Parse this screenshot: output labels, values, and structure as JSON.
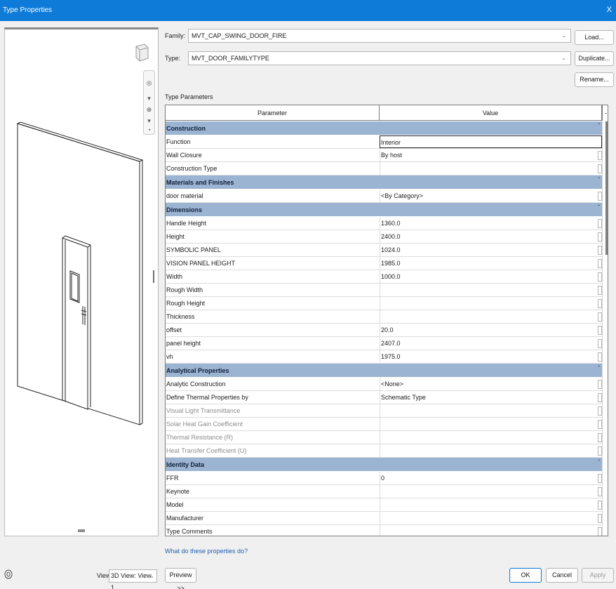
{
  "window": {
    "title": "Type Properties",
    "close_glyph": "X"
  },
  "family": {
    "label": "Family:",
    "value": "MVT_CAP_SWING_DOOR_FIRE",
    "load_button": "Load..."
  },
  "type": {
    "label": "Type:",
    "value": "MVT_DOOR_FAMILYTYPE",
    "duplicate_button": "Duplicate...",
    "rename_button": "Rename..."
  },
  "type_parameters_label": "Type Parameters",
  "table": {
    "header_parameter": "Parameter",
    "header_value": "Value",
    "header_minus": "-",
    "groups": [
      {
        "name": "Construction",
        "rows": [
          {
            "parameter": "Function",
            "value": "Interior",
            "selected": true
          },
          {
            "parameter": "Wall Closure",
            "value": "By host"
          },
          {
            "parameter": "Construction Type",
            "value": ""
          }
        ]
      },
      {
        "name": "Materials and Finishes",
        "rows": [
          {
            "parameter": "door material",
            "value": "<By Category>"
          }
        ]
      },
      {
        "name": "Dimensions",
        "rows": [
          {
            "parameter": "Handle Height",
            "value": "1360.0"
          },
          {
            "parameter": "Height",
            "value": "2400.0"
          },
          {
            "parameter": "SYMBOLIC PANEL",
            "value": "1024.0"
          },
          {
            "parameter": "VISION PANEL HEIGHT",
            "value": "1985.0"
          },
          {
            "parameter": "Width",
            "value": "1000.0"
          },
          {
            "parameter": "Rough Width",
            "value": ""
          },
          {
            "parameter": "Rough Height",
            "value": ""
          },
          {
            "parameter": "Thickness",
            "value": ""
          },
          {
            "parameter": "offset",
            "value": "20.0"
          },
          {
            "parameter": "panel height",
            "value": "2407.0"
          },
          {
            "parameter": "vh",
            "value": "1975.0"
          }
        ]
      },
      {
        "name": "Analytical Properties",
        "rows": [
          {
            "parameter": "Analytic Construction",
            "value": "<None>"
          },
          {
            "parameter": "Define Thermal Properties by",
            "value": "Schematic Type"
          },
          {
            "parameter": "Visual Light Transmittance",
            "value": "",
            "disabled": true
          },
          {
            "parameter": "Solar Heat Gain Coefficient",
            "value": "",
            "disabled": true
          },
          {
            "parameter": "Thermal Resistance (R)",
            "value": "",
            "disabled": true
          },
          {
            "parameter": "Heat Transfer Coefficient (U)",
            "value": "",
            "disabled": true
          }
        ]
      },
      {
        "name": "Identity Data",
        "rows": [
          {
            "parameter": "FFR",
            "value": "0"
          },
          {
            "parameter": "Keynote",
            "value": ""
          },
          {
            "parameter": "Model",
            "value": ""
          },
          {
            "parameter": "Manufacturer",
            "value": ""
          },
          {
            "parameter": "Type Comments",
            "value": ""
          }
        ]
      }
    ]
  },
  "help_link": "What do these properties do?",
  "footer": {
    "view_label": "View:",
    "view_value": "3D View: View 1",
    "preview_button": "Preview >>",
    "ok_button": "OK",
    "cancel_button": "Cancel",
    "apply_button": "Apply"
  },
  "colors": {
    "title_bar": "#0e7bd8",
    "group_header": "#9bb4d2"
  }
}
